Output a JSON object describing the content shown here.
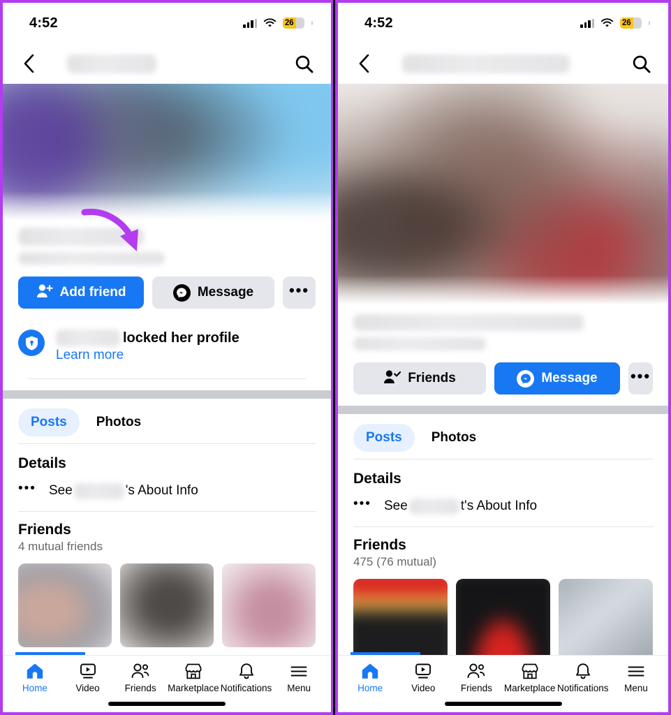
{
  "meta": {
    "accent_blue": "#1877f2",
    "annotation_purple": "#b43cf0",
    "grey_button": "#e4e6eb",
    "panel_border": "#b43cf0"
  },
  "status_bar": {
    "time": "4:52",
    "battery_level": "26",
    "signal_icon": "cellular-signal-icon",
    "wifi_icon": "wifi-icon",
    "battery_icon": "battery-icon"
  },
  "panels": [
    {
      "id": "left",
      "header": {
        "back_icon": "back-chevron-icon",
        "title_redacted": true,
        "search_icon": "search-icon"
      },
      "profile": {
        "cover_redacted": true,
        "name_redacted": true
      },
      "actions": [
        {
          "label": "Add friend",
          "style": "primary",
          "icon": "add-friend-icon"
        },
        {
          "label": "Message",
          "style": "grey",
          "icon": "messenger-icon"
        },
        {
          "label": "•••",
          "style": "grey",
          "icon": "more-options-icon"
        }
      ],
      "locked_notice": {
        "icon": "shield-lock-icon",
        "name_redacted": true,
        "title": "locked her profile",
        "link": "Learn more"
      },
      "tabs": [
        {
          "label": "Posts",
          "active": true
        },
        {
          "label": "Photos",
          "active": false
        }
      ],
      "details": {
        "heading": "Details",
        "dots_icon": "three-dots-icon",
        "text_before": "See",
        "text_after": "'s About Info",
        "name_redacted": true
      },
      "friends": {
        "heading": "Friends",
        "count_text": "4 mutual friends",
        "thumbnails": [
          "friend-photo-1",
          "friend-photo-2",
          "friend-photo-3"
        ]
      }
    },
    {
      "id": "right",
      "header": {
        "back_icon": "back-chevron-icon",
        "title_redacted": true,
        "search_icon": "search-icon"
      },
      "profile": {
        "cover_redacted": true,
        "name_redacted": true
      },
      "actions": [
        {
          "label": "Friends",
          "style": "grey",
          "icon": "friend-check-icon"
        },
        {
          "label": "Message",
          "style": "primary",
          "icon": "messenger-icon"
        },
        {
          "label": "•••",
          "style": "grey",
          "icon": "more-options-icon"
        }
      ],
      "tabs": [
        {
          "label": "Posts",
          "active": true
        },
        {
          "label": "Photos",
          "active": false
        }
      ],
      "details": {
        "heading": "Details",
        "dots_icon": "three-dots-icon",
        "text_before": "See",
        "text_after": "t's About Info",
        "name_redacted": true
      },
      "friends": {
        "heading": "Friends",
        "count_text": "475 (76 mutual)",
        "thumbnails": [
          "friend-photo-1",
          "friend-photo-2",
          "friend-photo-3"
        ]
      }
    }
  ],
  "bottom_nav": [
    {
      "label": "Home",
      "icon": "home-icon",
      "active": true
    },
    {
      "label": "Video",
      "icon": "video-icon",
      "active": false
    },
    {
      "label": "Friends",
      "icon": "friends-icon",
      "active": false
    },
    {
      "label": "Marketplace",
      "icon": "marketplace-icon",
      "active": false
    },
    {
      "label": "Notifications",
      "icon": "bell-icon",
      "active": false
    },
    {
      "label": "Menu",
      "icon": "hamburger-menu-icon",
      "active": false
    }
  ],
  "annotations": [
    {
      "id": "arrow-to-add-friend",
      "icon": "curved-arrow-icon",
      "color": "#b43cf0"
    },
    {
      "id": "arrow-to-friends-button",
      "icon": "curved-arrow-icon",
      "color": "#b43cf0"
    }
  ]
}
